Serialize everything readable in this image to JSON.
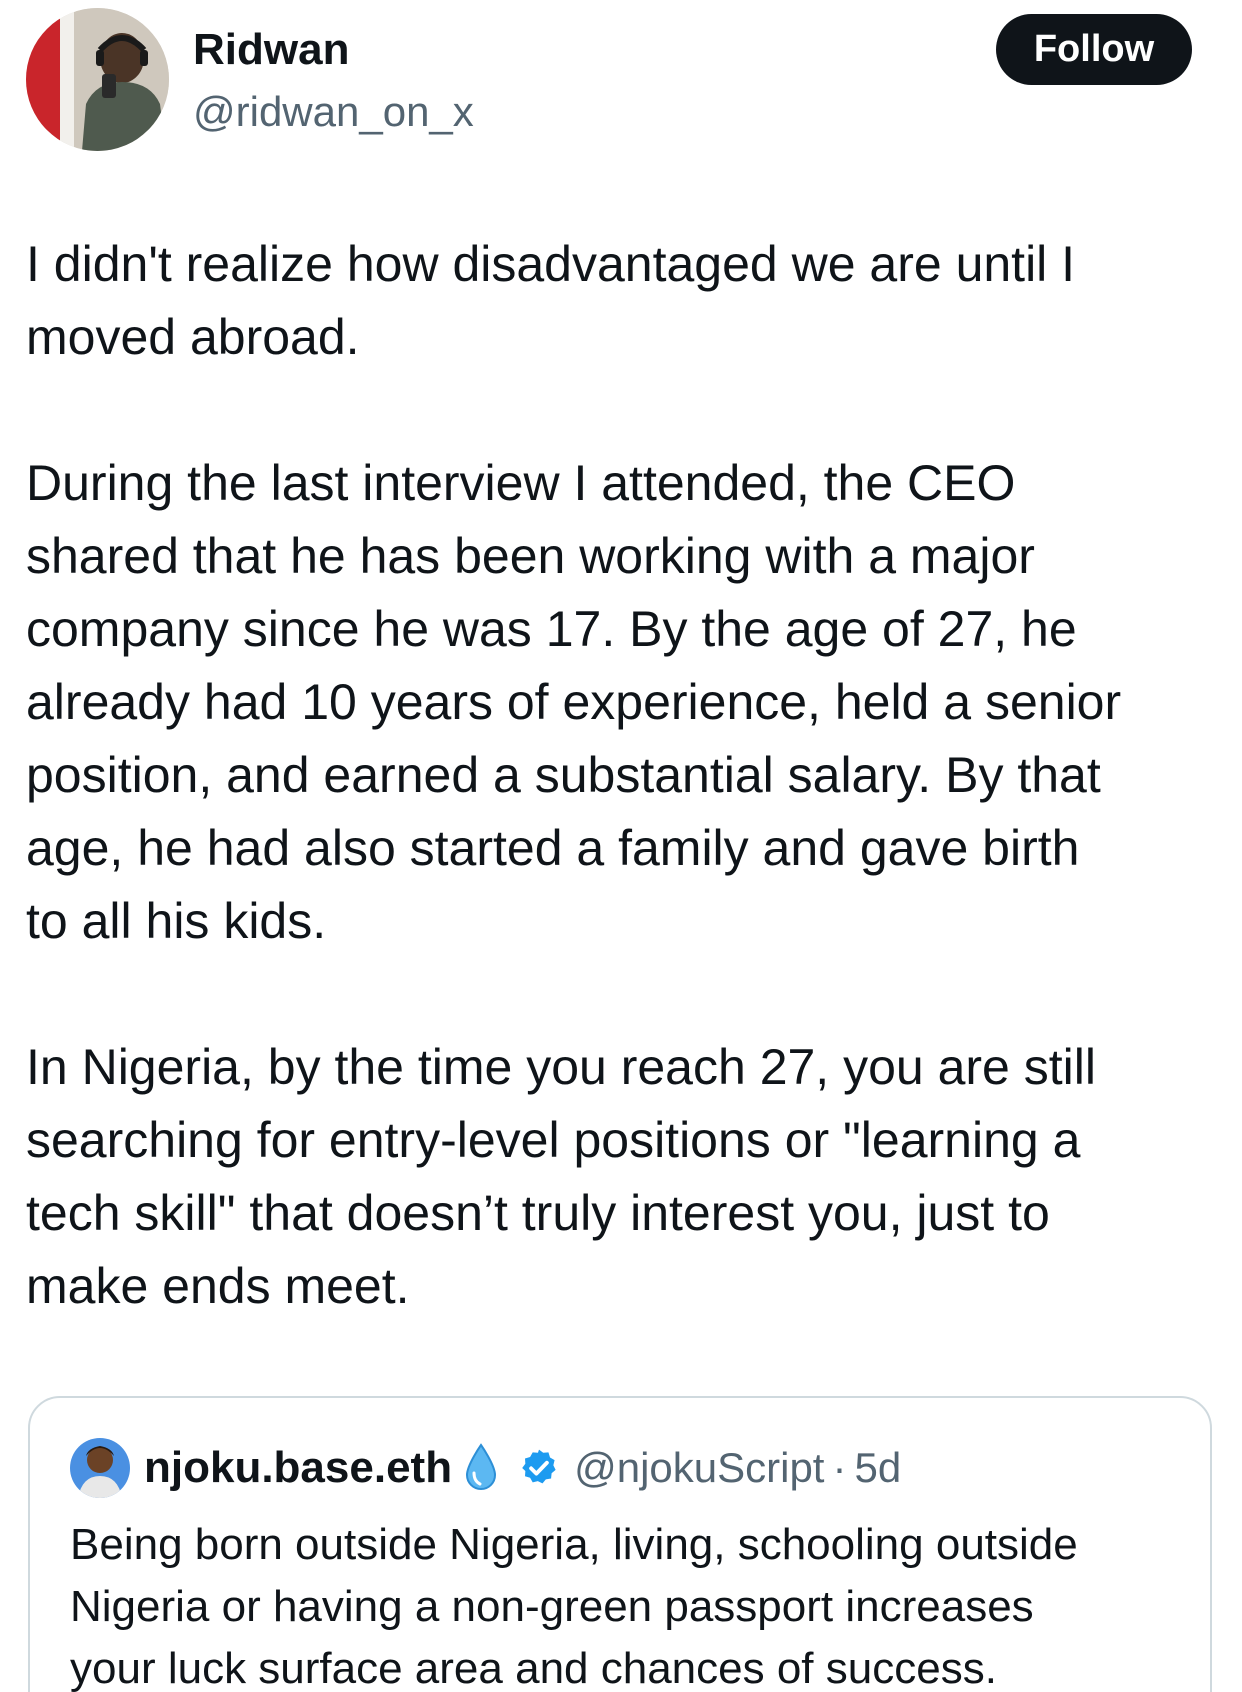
{
  "author": {
    "display_name": "Ridwan",
    "handle": "@ridwan_on_x",
    "avatar_icon": "profile-photo"
  },
  "follow_button": {
    "label": "Follow"
  },
  "tweet": {
    "paragraphs": [
      [
        "I didn't realize how disadvantaged we are until I",
        "moved abroad."
      ],
      [
        "During the last interview I attended, the CEO",
        "shared that he has been working with a major",
        "company since he was 17. By the age of 27, he",
        "already had 10 years of experience, held a senior",
        "position, and earned a substantial salary. By that",
        "age, he had also started a family and gave birth",
        "to all his kids."
      ],
      [
        "In Nigeria, by the time you reach 27, you are still",
        "searching for entry-level positions or \"learning a",
        "tech skill\" that doesn’t truly interest you, just to",
        "make ends meet."
      ]
    ]
  },
  "quoted_tweet": {
    "display_name": "njoku.base.eth",
    "emoji_icon": "droplet-icon",
    "verified_icon": "verified-badge-icon",
    "handle": "@njokuScript",
    "separator": "·",
    "time": "5d",
    "text_lines": [
      "Being born outside Nigeria, living, schooling outside",
      "Nigeria or having a non-green passport increases",
      "your luck surface area and chances of success."
    ]
  },
  "colors": {
    "text_primary": "#0f1419",
    "text_secondary": "#536471",
    "button_bg": "#0f1419",
    "verified_blue": "#1d9bf0",
    "card_border": "#cfd9de"
  }
}
